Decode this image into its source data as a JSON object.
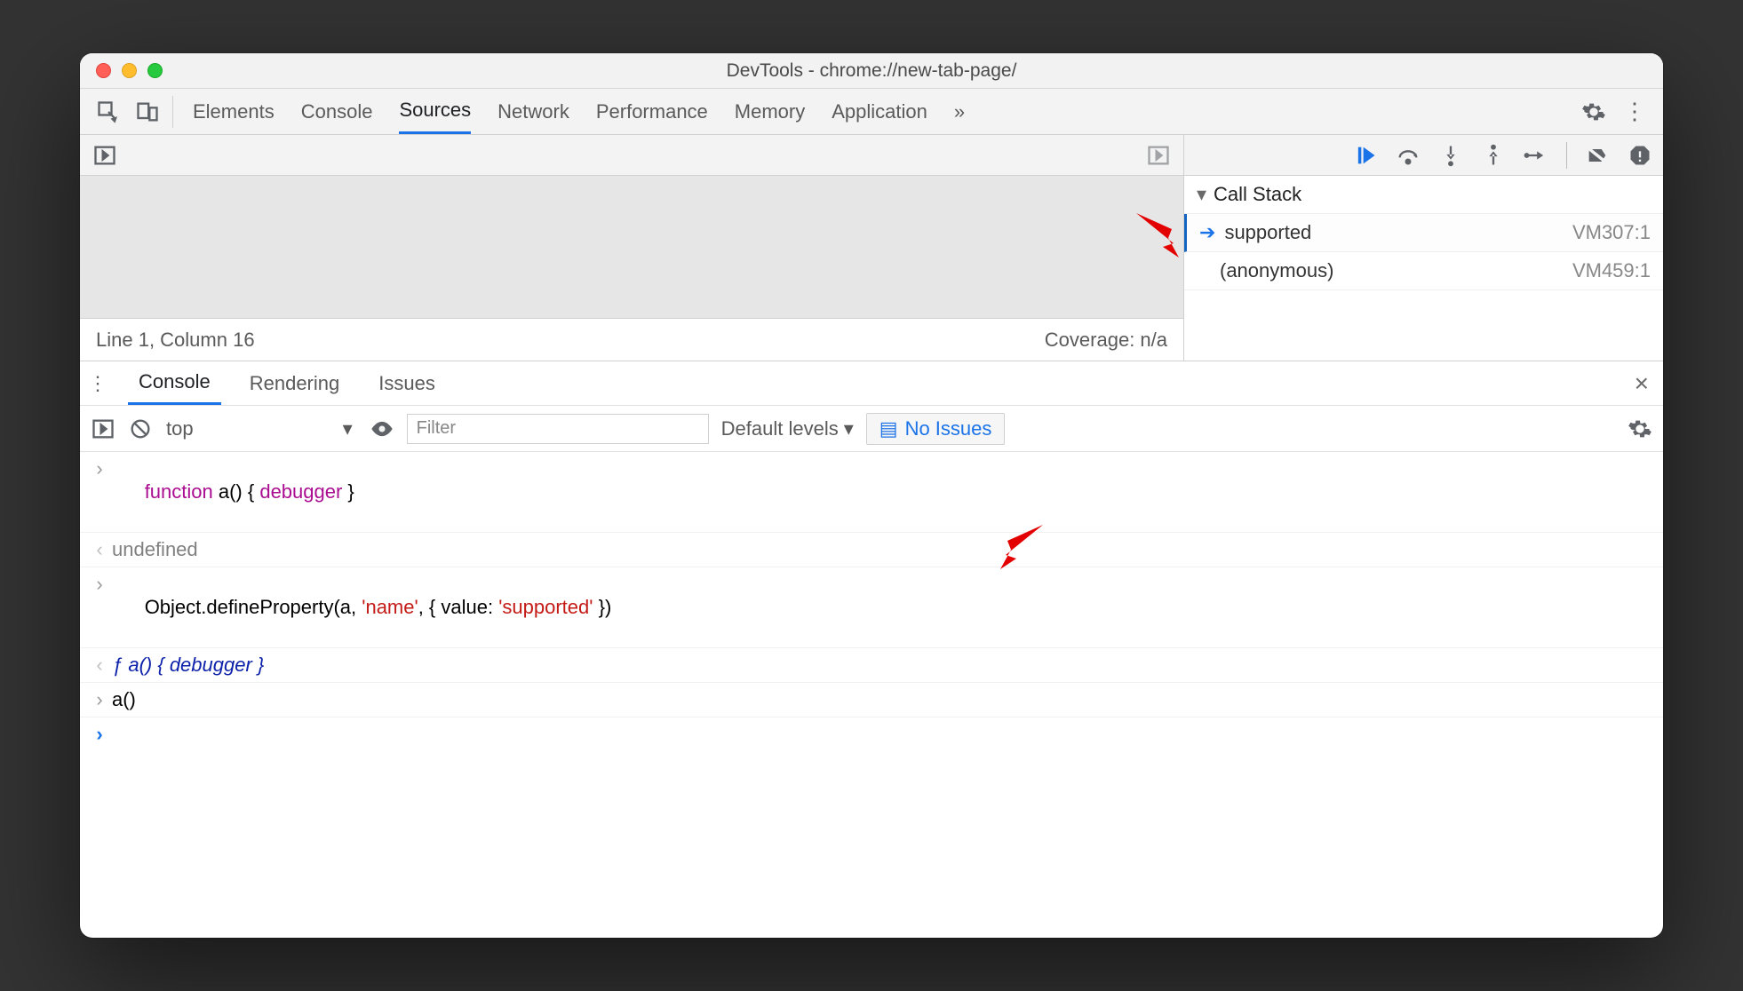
{
  "window": {
    "title": "DevTools - chrome://new-tab-page/"
  },
  "tabs": {
    "items": [
      "Elements",
      "Console",
      "Sources",
      "Network",
      "Performance",
      "Memory",
      "Application"
    ],
    "active": 2,
    "overflow": "»"
  },
  "editor": {
    "status_left": "Line 1, Column 16",
    "status_right": "Coverage: n/a"
  },
  "debugger": {
    "section_title": "Call Stack",
    "frames": [
      {
        "name": "supported",
        "source": "VM307:1",
        "current": true
      },
      {
        "name": "(anonymous)",
        "source": "VM459:1",
        "current": false
      }
    ]
  },
  "drawer": {
    "tabs": [
      "Console",
      "Rendering",
      "Issues"
    ],
    "active": 0
  },
  "console_tool": {
    "context": "top",
    "filter_placeholder": "Filter",
    "levels": "Default levels",
    "issues_chip": "No Issues"
  },
  "console_lines": {
    "l0": {
      "kw_function": "function",
      "fn": " a() { ",
      "kw_debugger": "debugger",
      "tail": " }"
    },
    "l1": {
      "text": "undefined"
    },
    "l2": {
      "pre": "Object.defineProperty(a, ",
      "s1": "'name'",
      "mid": ", { value: ",
      "s2": "'supported'",
      "post": " })"
    },
    "l3": {
      "f": "ƒ ",
      "body": "a() { debugger }"
    },
    "l4": {
      "text": "a()"
    }
  }
}
